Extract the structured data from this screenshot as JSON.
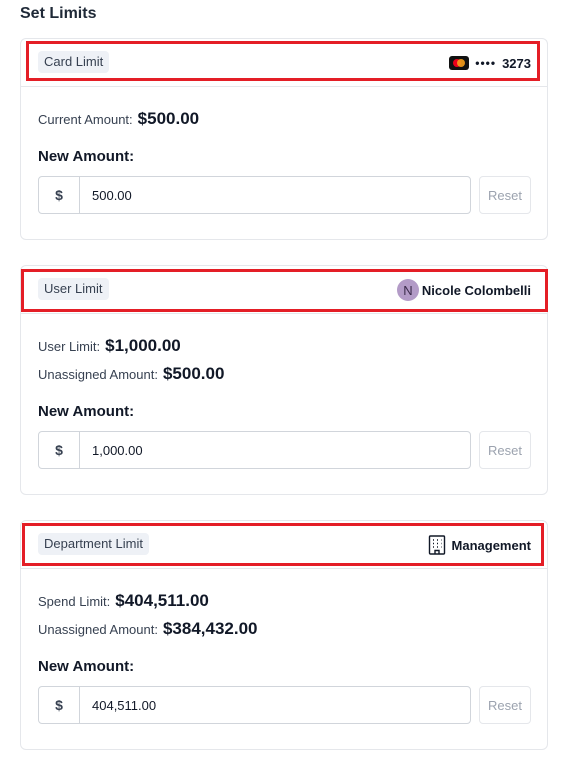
{
  "page_title": "Set Limits",
  "colors": {
    "highlight": "#e41e26",
    "tag_bg": "#eef1f6",
    "avatar_bg": "#b39bc7"
  },
  "card_limit": {
    "tag": "Card Limit",
    "card_icon": "mastercard-icon",
    "card_dots": "••••",
    "card_last4": "3273",
    "current_label": "Current Amount:",
    "current_value": "$500.00",
    "new_amount_label": "New Amount:",
    "currency_symbol": "$",
    "input_value": "500.00",
    "reset_label": "Reset"
  },
  "user_limit": {
    "tag": "User Limit",
    "avatar_initial": "N",
    "user_name": "Nicole Colombelli",
    "limit_label": "User Limit:",
    "limit_value": "$1,000.00",
    "unassigned_label": "Unassigned Amount:",
    "unassigned_value": "$500.00",
    "new_amount_label": "New Amount:",
    "currency_symbol": "$",
    "input_value": "1,000.00",
    "reset_label": "Reset"
  },
  "department_limit": {
    "tag": "Department Limit",
    "department_icon": "building-icon",
    "department_name": "Management",
    "limit_label": "Spend Limit:",
    "limit_value": "$404,511.00",
    "unassigned_label": "Unassigned Amount:",
    "unassigned_value": "$384,432.00",
    "new_amount_label": "New Amount:",
    "currency_symbol": "$",
    "input_value": "404,511.00",
    "reset_label": "Reset"
  }
}
